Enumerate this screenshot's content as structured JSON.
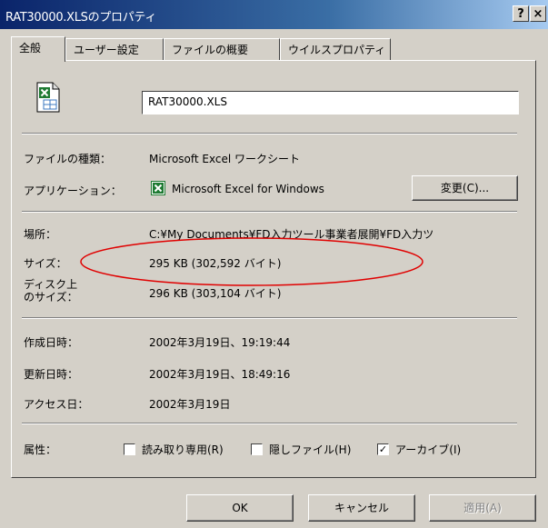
{
  "window": {
    "title": "RAT30000.XLSのプロパティ",
    "help_button": "?",
    "close_button": "×"
  },
  "tabs": [
    {
      "label": "全般",
      "active": true
    },
    {
      "label": "ユーザー設定",
      "active": false
    },
    {
      "label": "ファイルの概要",
      "active": false
    },
    {
      "label": "ウイルスプロパティ",
      "active": false
    }
  ],
  "general": {
    "file_icon": "excel-file-icon",
    "filename": "RAT30000.XLS",
    "type_label": "ファイルの種類：",
    "type_value": "Microsoft Excel ワークシート",
    "app_label": "アプリケーション：",
    "app_icon": "excel-app-icon",
    "app_value": "Microsoft Excel for Windows",
    "change_button": "変更(C)...",
    "location_label": "場所：",
    "location_value": "C:¥My Documents¥FD入力ツール事業者展開¥FD入力ツ",
    "size_label": "サイズ：",
    "size_value": "295 KB (302,592 バイト)",
    "size_on_disk_label_1": "ディスク上",
    "size_on_disk_label_2": "のサイズ：",
    "size_on_disk_value": "296 KB (303,104 バイト)",
    "created_label": "作成日時：",
    "created_value": "2002年3月19日、19:19:44",
    "modified_label": "更新日時：",
    "modified_value": "2002年3月19日、18:49:16",
    "accessed_label": "アクセス日：",
    "accessed_value": "2002年3月19日",
    "attributes_label": "属性：",
    "attributes": [
      {
        "label": "読み取り専用(R)",
        "checked": false
      },
      {
        "label": "隠しファイル(H)",
        "checked": false
      },
      {
        "label": "アーカイブ(I)",
        "checked": true
      }
    ]
  },
  "footer": {
    "ok": "OK",
    "cancel": "キャンセル",
    "apply": "適用(A)"
  },
  "colors": {
    "title_active": "#0a246a",
    "dialog_face": "#d4d0c8",
    "highlight_ellipse": "#e00000"
  }
}
